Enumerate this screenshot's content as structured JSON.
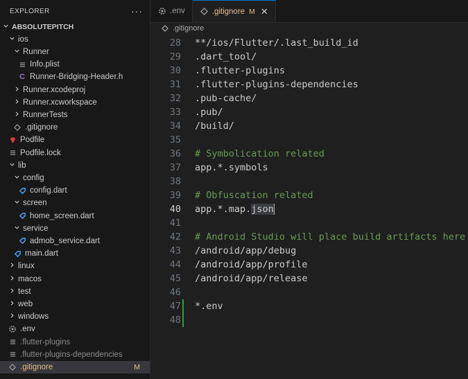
{
  "explorer": {
    "title": "EXPLORER",
    "more": "···",
    "tree": [
      {
        "label": "ABSOLUTEPITCH",
        "depth": 0,
        "chev": "down",
        "icon": "",
        "root": true
      },
      {
        "label": "ios",
        "depth": 1,
        "chev": "down",
        "icon": ""
      },
      {
        "label": "Runner",
        "depth": 2,
        "chev": "down",
        "icon": ""
      },
      {
        "label": "Info.plist",
        "depth": 3,
        "chev": "",
        "icon": "list-icon"
      },
      {
        "label": "Runner-Bridging-Header.h",
        "depth": 3,
        "chev": "",
        "icon": "c-header-icon",
        "icon_text": "C"
      },
      {
        "label": "Runner.xcodeproj",
        "depth": 2,
        "chev": "right",
        "icon": ""
      },
      {
        "label": "Runner.xcworkspace",
        "depth": 2,
        "chev": "right",
        "icon": ""
      },
      {
        "label": "RunnerTests",
        "depth": 2,
        "chev": "right",
        "icon": ""
      },
      {
        "label": ".gitignore",
        "depth": 2,
        "chev": "",
        "icon": "gitignore-icon"
      },
      {
        "label": "Podfile",
        "depth": 1,
        "chev": "",
        "icon": "ruby-icon"
      },
      {
        "label": "Podfile.lock",
        "depth": 1,
        "chev": "",
        "icon": "list-icon"
      },
      {
        "label": "lib",
        "depth": 1,
        "chev": "down",
        "icon": ""
      },
      {
        "label": "config",
        "depth": 2,
        "chev": "down",
        "icon": ""
      },
      {
        "label": "config.dart",
        "depth": 3,
        "chev": "",
        "icon": "dart-icon"
      },
      {
        "label": "screen",
        "depth": 2,
        "chev": "down",
        "icon": ""
      },
      {
        "label": "home_screen.dart",
        "depth": 3,
        "chev": "",
        "icon": "dart-icon"
      },
      {
        "label": "service",
        "depth": 2,
        "chev": "down",
        "icon": ""
      },
      {
        "label": "admob_service.dart",
        "depth": 3,
        "chev": "",
        "icon": "dart-icon"
      },
      {
        "label": "main.dart",
        "depth": 2,
        "chev": "",
        "icon": "dart-icon"
      },
      {
        "label": "linux",
        "depth": 1,
        "chev": "right",
        "icon": ""
      },
      {
        "label": "macos",
        "depth": 1,
        "chev": "right",
        "icon": ""
      },
      {
        "label": "test",
        "depth": 1,
        "chev": "right",
        "icon": ""
      },
      {
        "label": "web",
        "depth": 1,
        "chev": "right",
        "icon": ""
      },
      {
        "label": "windows",
        "depth": 1,
        "chev": "right",
        "icon": ""
      },
      {
        "label": ".env",
        "depth": 1,
        "chev": "",
        "icon": "gear-icon"
      },
      {
        "label": ".flutter-plugins",
        "depth": 1,
        "chev": "",
        "icon": "list-icon",
        "dim": true
      },
      {
        "label": ".flutter-plugins-dependencies",
        "depth": 1,
        "chev": "",
        "icon": "list-icon",
        "dim": true
      },
      {
        "label": ".gitignore",
        "depth": 1,
        "chev": "",
        "icon": "gitignore-icon",
        "selected": true,
        "badge": "M"
      }
    ]
  },
  "tabs": [
    {
      "label": ".env",
      "icon": "gear-icon",
      "active": false
    },
    {
      "label": ".gitignore",
      "icon": "gitignore-icon",
      "active": true,
      "badge": "M",
      "close": "✕"
    }
  ],
  "breadcrumb": {
    "label": ".gitignore"
  },
  "editor": {
    "current_line": "40",
    "lines": [
      {
        "n": "28",
        "text": "**/ios/Flutter/.last_build_id",
        "kind": "plain"
      },
      {
        "n": "29",
        "text": ".dart_tool/",
        "kind": "plain"
      },
      {
        "n": "30",
        "text": ".flutter-plugins",
        "kind": "plain"
      },
      {
        "n": "31",
        "text": ".flutter-plugins-dependencies",
        "kind": "plain"
      },
      {
        "n": "32",
        "text": ".pub-cache/",
        "kind": "plain"
      },
      {
        "n": "33",
        "text": ".pub/",
        "kind": "plain"
      },
      {
        "n": "34",
        "text": "/build/",
        "kind": "plain"
      },
      {
        "n": "35",
        "text": "",
        "kind": "plain"
      },
      {
        "n": "36",
        "text": "# Symbolication related",
        "kind": "comment"
      },
      {
        "n": "37",
        "text": "app.*.symbols",
        "kind": "plain"
      },
      {
        "n": "38",
        "text": "",
        "kind": "plain"
      },
      {
        "n": "39",
        "text": "# Obfuscation related",
        "kind": "comment"
      },
      {
        "n": "40",
        "text": "app.*.map.",
        "kind": "plain",
        "highlight": "json"
      },
      {
        "n": "41",
        "text": "",
        "kind": "plain"
      },
      {
        "n": "42",
        "text": "# Android Studio will place build artifacts here",
        "kind": "comment"
      },
      {
        "n": "43",
        "text": "/android/app/debug",
        "kind": "plain"
      },
      {
        "n": "44",
        "text": "/android/app/profile",
        "kind": "plain"
      },
      {
        "n": "45",
        "text": "/android/app/release",
        "kind": "plain"
      },
      {
        "n": "46",
        "text": "",
        "kind": "plain"
      },
      {
        "n": "47",
        "text": "*.env",
        "kind": "plain",
        "added": true
      },
      {
        "n": "48",
        "text": "",
        "kind": "plain",
        "added": true
      }
    ]
  },
  "colors": {
    "modified": "#e2c08d",
    "comment": "#6a9955",
    "added_gutter": "#2ea043",
    "dart": "#42a5f5",
    "ruby": "#e53935",
    "c_header": "#a074c4"
  }
}
